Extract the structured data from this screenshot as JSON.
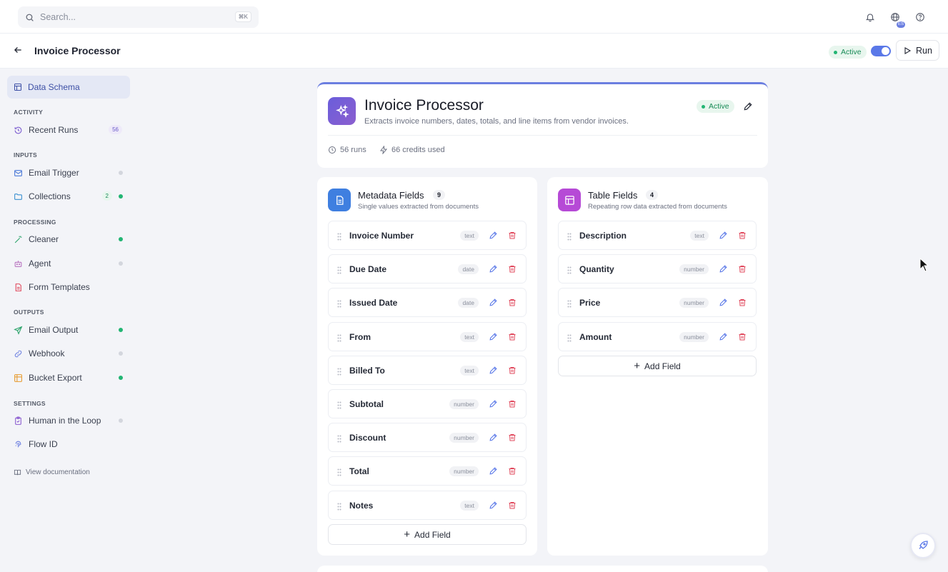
{
  "search": {
    "placeholder": "Search...",
    "shortcut": "⌘K"
  },
  "top_icons": {
    "globe_badge": "ES"
  },
  "header": {
    "title": "Invoice Processor",
    "status": "Active",
    "run_label": "Run"
  },
  "sidebar": {
    "active_item": "Data Schema",
    "sections": {
      "activity": "ACTIVITY",
      "inputs": "INPUTS",
      "processing": "PROCESSING",
      "outputs": "OUTPUTS",
      "settings": "SETTINGS"
    },
    "items": {
      "recent_runs": {
        "label": "Recent Runs",
        "count": "56"
      },
      "email_trigger": {
        "label": "Email Trigger"
      },
      "collections": {
        "label": "Collections",
        "count": "2"
      },
      "cleaner": {
        "label": "Cleaner"
      },
      "agent": {
        "label": "Agent"
      },
      "form_templates": {
        "label": "Form Templates"
      },
      "email_output": {
        "label": "Email Output"
      },
      "webhook": {
        "label": "Webhook"
      },
      "bucket_export": {
        "label": "Bucket Export"
      },
      "human_loop": {
        "label": "Human in the Loop"
      },
      "flow_id": {
        "label": "Flow ID"
      }
    },
    "doc_link": "View documentation"
  },
  "main": {
    "title": "Invoice Processor",
    "description": "Extracts invoice numbers, dates, totals, and line items from vendor invoices.",
    "status": "Active",
    "runs": "56 runs",
    "credits": "66 credits used"
  },
  "metadata": {
    "title": "Metadata Fields",
    "count": "9",
    "subtitle": "Single values extracted from documents",
    "fields": [
      {
        "name": "Invoice Number",
        "type": "text"
      },
      {
        "name": "Due Date",
        "type": "date"
      },
      {
        "name": "Issued Date",
        "type": "date"
      },
      {
        "name": "From",
        "type": "text"
      },
      {
        "name": "Billed To",
        "type": "text"
      },
      {
        "name": "Subtotal",
        "type": "number"
      },
      {
        "name": "Discount",
        "type": "number"
      },
      {
        "name": "Total",
        "type": "number"
      },
      {
        "name": "Notes",
        "type": "text"
      }
    ],
    "add_label": "Add Field"
  },
  "table": {
    "title": "Table Fields",
    "count": "4",
    "subtitle": "Repeating row data extracted from documents",
    "fields": [
      {
        "name": "Description",
        "type": "text"
      },
      {
        "name": "Quantity",
        "type": "number"
      },
      {
        "name": "Price",
        "type": "number"
      },
      {
        "name": "Amount",
        "type": "number"
      }
    ],
    "add_label": "Add Field"
  },
  "colors": {
    "accent": "#5a78e8",
    "active_green": "#22b573",
    "delete_red": "#e0475b"
  }
}
